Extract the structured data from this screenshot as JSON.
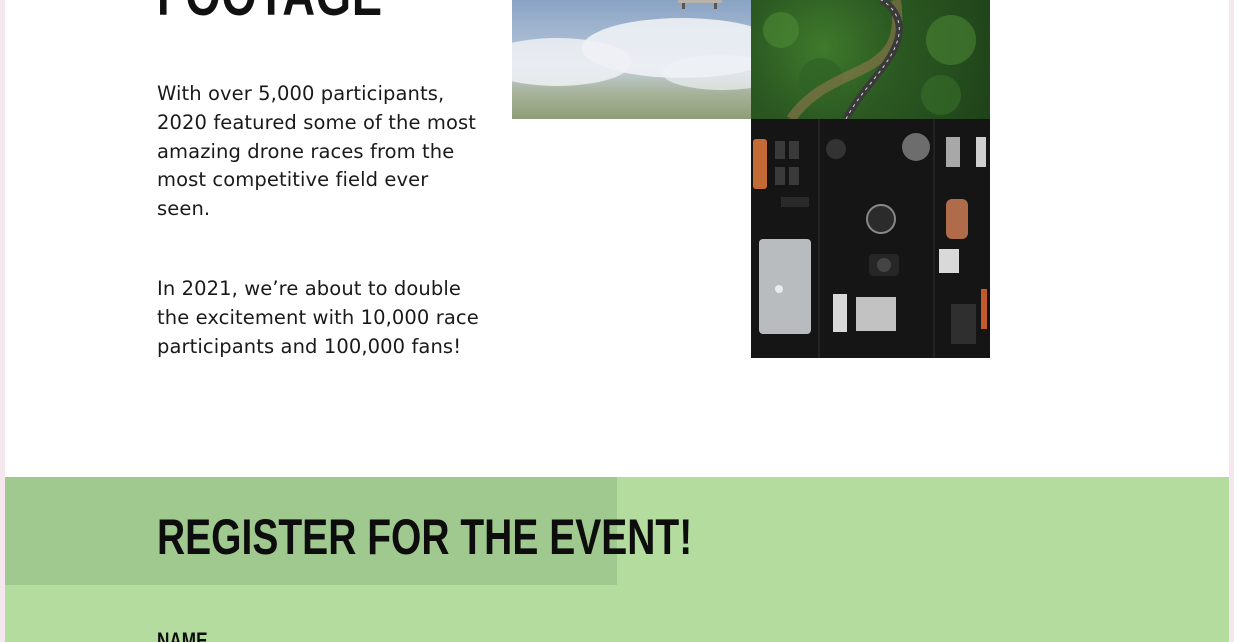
{
  "section": {
    "title": "FOOTAGE",
    "paragraphs": [
      "With over 5,000 participants, 2020 featured some of the most amazing drone races from the most competitive field ever seen.",
      "In 2021, we’re about to double the excitement with 10,000 race participants and 100,000 fans!"
    ]
  },
  "register": {
    "title": "REGISTER FOR THE EVENT!",
    "name_label": "NAME"
  },
  "colors": {
    "register_band": "#b3dc9e",
    "register_header": "#9fc98e"
  }
}
